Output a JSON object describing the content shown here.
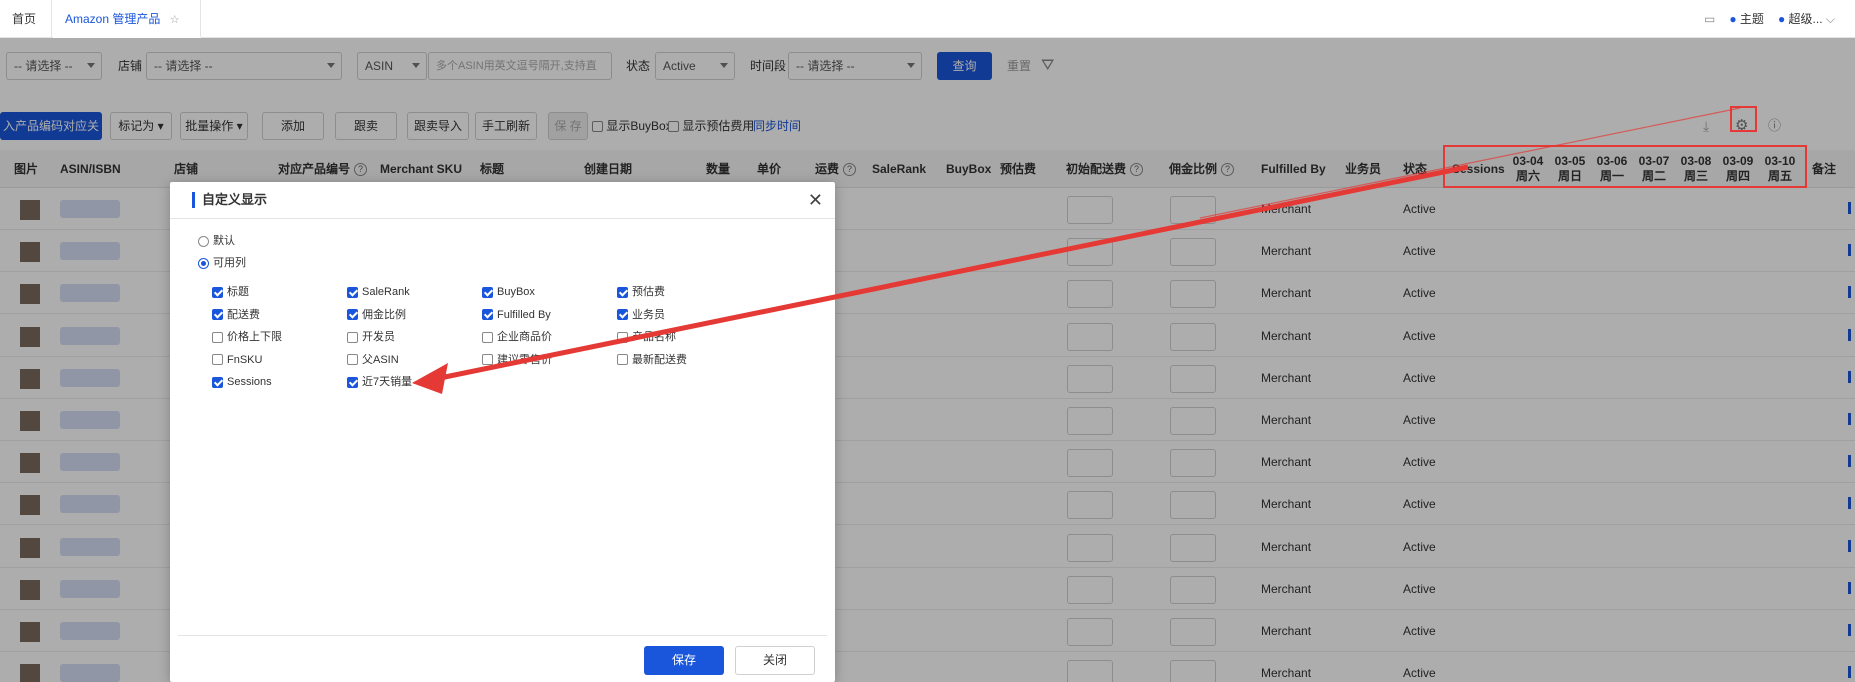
{
  "tabs": {
    "home": "首页",
    "active": "Amazon 管理产品"
  },
  "topbar": {
    "theme": "主题",
    "user": "超级..."
  },
  "filters": {
    "sel1": "-- 请选择 --",
    "shop_label": "店铺",
    "shop_value": "-- 请选择 --",
    "asin_type": "ASIN",
    "asin_placeholder": "多个ASIN用英文逗号隔开,支持直",
    "status_label": "状态",
    "status_value": "Active",
    "period_label": "时间段",
    "period_value": "-- 请选择 --",
    "query": "查询",
    "reset": "重置"
  },
  "toolbar": {
    "import_btn": "入产品编码对应关系",
    "mark_as": "标记为",
    "batch_ops": "批量操作",
    "add": "添加",
    "track": "跟卖",
    "track_import": "跟卖导入",
    "manual_refresh": "手工刷新",
    "save": "保 存",
    "show_buybox": "显示BuyBox",
    "show_fee": "显示预估费用",
    "sync_time": "同步时间"
  },
  "table": {
    "headers": {
      "image": "图片",
      "asin": "ASIN/ISBN",
      "shop": "店铺",
      "product_code": "对应产品编号",
      "merchant_sku": "Merchant SKU",
      "title": "标题",
      "created": "创建日期",
      "qty": "数量",
      "price": "单价",
      "shipping": "运费",
      "salerank": "SaleRank",
      "buybox": "BuyBox",
      "est_fee": "预估费",
      "init_ship": "初始配送费",
      "commission": "佣金比例",
      "fulfilled_by": "Fulfilled By",
      "salesman": "业务员",
      "status": "状态",
      "sessions": "Sessions",
      "remark": "备注"
    },
    "days": [
      {
        "date": "03-04",
        "weekday": "周六"
      },
      {
        "date": "03-05",
        "weekday": "周日"
      },
      {
        "date": "03-06",
        "weekday": "周一"
      },
      {
        "date": "03-07",
        "weekday": "周二"
      },
      {
        "date": "03-08",
        "weekday": "周三"
      },
      {
        "date": "03-09",
        "weekday": "周四"
      },
      {
        "date": "03-10",
        "weekday": "周五"
      }
    ],
    "rows": [
      {
        "fulfilled": "Merchant",
        "status": "Active"
      },
      {
        "fulfilled": "Merchant",
        "status": "Active"
      },
      {
        "fulfilled": "Merchant",
        "status": "Active"
      },
      {
        "fulfilled": "Merchant",
        "status": "Active"
      },
      {
        "fulfilled": "Merchant",
        "status": "Active"
      },
      {
        "fulfilled": "Merchant",
        "status": "Active"
      },
      {
        "fulfilled": "Merchant",
        "status": "Active"
      },
      {
        "fulfilled": "Merchant",
        "status": "Active"
      },
      {
        "fulfilled": "Merchant",
        "status": "Active"
      },
      {
        "fulfilled": "Merchant",
        "status": "Active"
      },
      {
        "fulfilled": "Merchant",
        "status": "Active"
      },
      {
        "fulfilled": "Merchant",
        "status": "Active"
      }
    ]
  },
  "modal": {
    "title": "自定义显示",
    "radio_default": "默认",
    "radio_available": "可用列",
    "options": [
      {
        "label": "标题",
        "checked": true
      },
      {
        "label": "SaleRank",
        "checked": true
      },
      {
        "label": "BuyBox",
        "checked": true
      },
      {
        "label": "预估费",
        "checked": true
      },
      {
        "label": "配送费",
        "checked": true
      },
      {
        "label": "佣金比例",
        "checked": true
      },
      {
        "label": "Fulfilled By",
        "checked": true
      },
      {
        "label": "业务员",
        "checked": true
      },
      {
        "label": "价格上下限",
        "checked": false
      },
      {
        "label": "开发员",
        "checked": false
      },
      {
        "label": "企业商品价",
        "checked": false
      },
      {
        "label": "产品名称",
        "checked": false
      },
      {
        "label": "FnSKU",
        "checked": false
      },
      {
        "label": "父ASIN",
        "checked": false
      },
      {
        "label": "建议零售价",
        "checked": false
      },
      {
        "label": "最新配送费",
        "checked": false
      },
      {
        "label": "Sessions",
        "checked": true
      },
      {
        "label": "近7天销量",
        "checked": true
      }
    ],
    "save": "保存",
    "close": "关闭"
  },
  "colors": {
    "primary": "#1a56db",
    "annotation": "#e53935"
  }
}
